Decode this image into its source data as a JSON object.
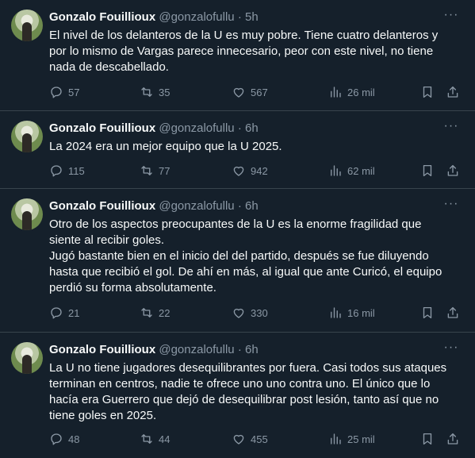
{
  "tweets": [
    {
      "name": "Gonzalo Fouillioux",
      "handle": "@gonzalofullu",
      "separator": "·",
      "time": "5h",
      "lines": [
        "El nivel de los delanteros de la U es muy pobre. Tiene cuatro delanteros y",
        "por lo mismo de Vargas parece innecesario, peor con este nivel, no tiene",
        "nada de descabellado."
      ],
      "replies": "57",
      "retweets": "35",
      "likes": "567",
      "views": "26 mil"
    },
    {
      "name": "Gonzalo Fouillioux",
      "handle": "@gonzalofullu",
      "separator": "·",
      "time": "6h",
      "lines": [
        "La 2024 era un mejor equipo que la U 2025."
      ],
      "replies": "115",
      "retweets": "77",
      "likes": "942",
      "views": "62 mil"
    },
    {
      "name": "Gonzalo Fouillioux",
      "handle": "@gonzalofullu",
      "separator": "·",
      "time": "6h",
      "lines": [
        "Otro de los aspectos preocupantes de la U es la enorme fragilidad que",
        "siente al recibir goles.",
        "Jugó bastante bien en el inicio del del partido, después se fue diluyendo",
        "hasta que recibió el gol. De ahí en más, al igual que ante Curicó, el equipo",
        "perdió su forma absolutamente."
      ],
      "replies": "21",
      "retweets": "22",
      "likes": "330",
      "views": "16 mil"
    },
    {
      "name": "Gonzalo Fouillioux",
      "handle": "@gonzalofullu",
      "separator": "·",
      "time": "6h",
      "lines": [
        "La U no tiene jugadores desequilibrantes por fuera. Casi todos sus ataques",
        "terminan en centros, nadie te ofrece uno uno contra uno. El único que lo",
        "hacía era Guerrero que dejó de desequilibrar post lesión, tanto así que no",
        "tiene goles en 2025."
      ],
      "replies": "48",
      "retweets": "44",
      "likes": "455",
      "views": "25 mil"
    }
  ],
  "icons": {
    "more": "more-options-icon",
    "reply": "reply-icon",
    "retweet": "retweet-icon",
    "like": "heart-icon",
    "views": "views-icon",
    "bookmark": "bookmark-icon",
    "share": "share-icon"
  },
  "colors": {
    "background": "#15202b",
    "text": "#f7f9f9",
    "muted": "#8b98a5",
    "divider": "#38444d"
  }
}
